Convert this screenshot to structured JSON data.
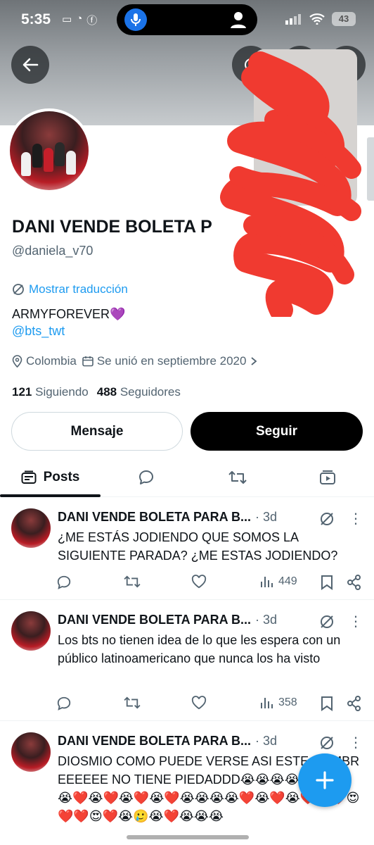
{
  "status_bar": {
    "time": "5:35",
    "battery": "43"
  },
  "profile": {
    "name": "DANI VENDE BOLETA P",
    "handle": "@daniela_v70",
    "translate_label": "Mostrar traducción",
    "bio": "ARMYFOREVER💜",
    "bio_link": "@bts_twt",
    "location": "Colombia",
    "joined": "Se unió en septiembre 2020",
    "following_count": "121",
    "following_label": "Siguiendo",
    "followers_count": "488",
    "followers_label": "Seguidores",
    "message_button": "Mensaje",
    "follow_button": "Seguir"
  },
  "tabs": {
    "posts_label": "Posts"
  },
  "posts": [
    {
      "author": "DANI VENDE BOLETA PARA B...",
      "date": "· 3d",
      "text": "¿ME ESTÁS JODIENDO QUE SOMOS LA SIGUIENTE PARADA? ¿ME ESTAS JODIENDO?",
      "views": "449"
    },
    {
      "author": "DANI VENDE BOLETA PARA B...",
      "date": "· 3d",
      "text": "Los bts no tienen idea de lo que les espera con un público latinoamericano que nunca los ha visto",
      "views": "358"
    },
    {
      "author": "DANI VENDE BOLETA PARA B...",
      "date": "· 3d",
      "text": "DIOSMIO COMO PUEDE VERSE ASI ESTE HOMBREEEEEE NO TIENE PIEDADDD😭😭😭😭❤️😭❤️😭❤️😭❤️😭❤️😭❤️😭😭😭😭❤️😭❤️😭❤️😭❤️😍❤️❤️😍❤️😭🥲😭❤️😭😭😭"
    }
  ],
  "colors": {
    "accent": "#1d9bf0",
    "text": "#0f1419",
    "muted": "#536471",
    "redaction": "#f03a30"
  }
}
